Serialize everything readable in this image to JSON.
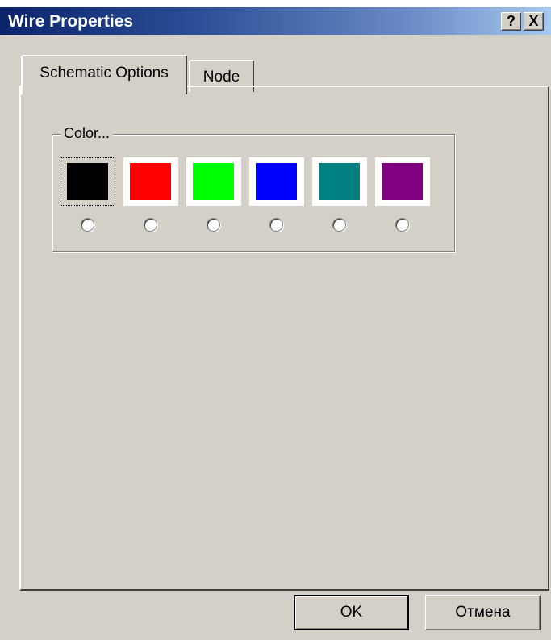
{
  "window": {
    "title": "Wire Properties",
    "help_label": "?",
    "close_label": "X"
  },
  "tabs": [
    {
      "label": "Schematic Options",
      "active": true
    },
    {
      "label": "Node",
      "active": false
    }
  ],
  "color_group": {
    "label": "Color...",
    "swatches": [
      {
        "name": "black",
        "color": "#000000",
        "focused": true,
        "selected": false
      },
      {
        "name": "red",
        "color": "#ff0000",
        "focused": false,
        "selected": false
      },
      {
        "name": "green",
        "color": "#00ff00",
        "focused": false,
        "selected": false
      },
      {
        "name": "blue",
        "color": "#0000ff",
        "focused": false,
        "selected": false
      },
      {
        "name": "teal",
        "color": "#008080",
        "focused": false,
        "selected": false
      },
      {
        "name": "purple",
        "color": "#800080",
        "focused": false,
        "selected": false
      }
    ]
  },
  "buttons": {
    "ok_label": "OK",
    "cancel_label": "Отмена"
  }
}
